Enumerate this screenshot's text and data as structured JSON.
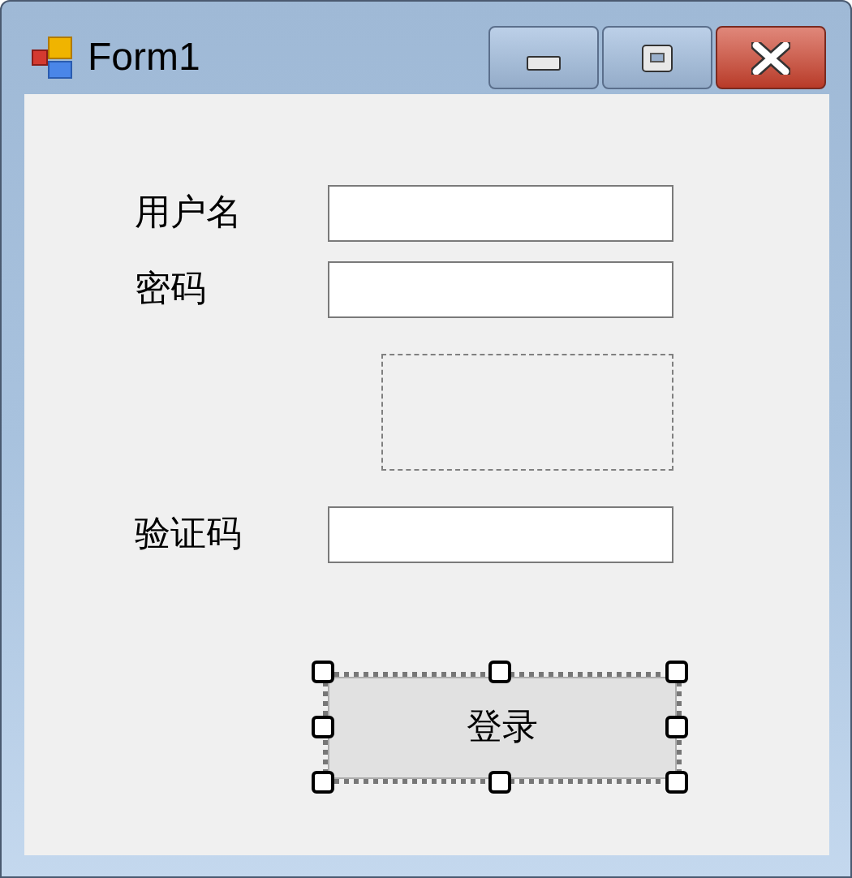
{
  "window": {
    "title": "Form1"
  },
  "fields": [
    {
      "label": "用户名",
      "kind": "textbox"
    },
    {
      "label": "密码",
      "kind": "textbox"
    },
    {
      "kind": "picturebox"
    },
    {
      "label": "验证码",
      "kind": "textbox"
    }
  ],
  "button": {
    "label": "登录",
    "selected": true
  }
}
